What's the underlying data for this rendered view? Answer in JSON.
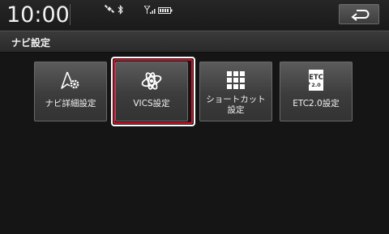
{
  "statusbar": {
    "clock": "10:00"
  },
  "header": {
    "title": "ナビ設定"
  },
  "tiles": [
    {
      "label": "ナビ詳細設定",
      "icon": "navi-settings-icon"
    },
    {
      "label": "VICS設定",
      "icon": "vics-icon",
      "selected": true
    },
    {
      "label": "ショートカット\n設定",
      "icon": "grid-icon"
    },
    {
      "label": "ETC2.0設定",
      "icon": "etc-card-icon",
      "icon_text_top": "ETC",
      "icon_text_bottom": "2.0"
    }
  ],
  "colors": {
    "background": "#151515",
    "selection": "#d8102a"
  }
}
